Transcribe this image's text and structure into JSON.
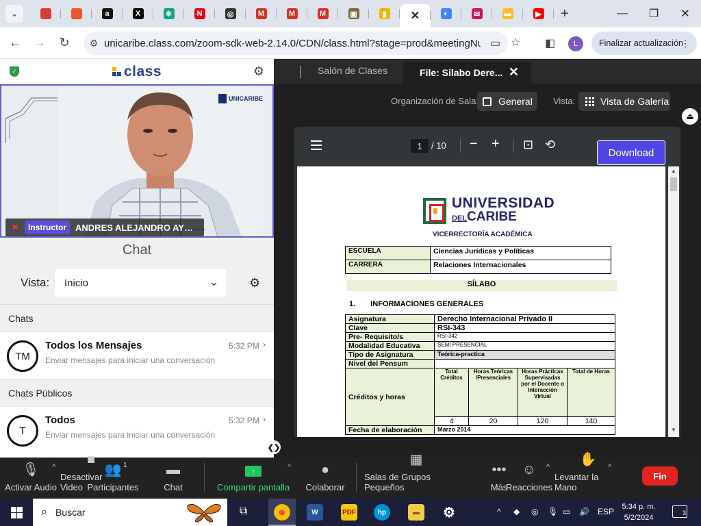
{
  "browser": {
    "tabs": [
      {
        "icon": "tab-dropdown-icon"
      },
      {
        "icon": "partner-logo-icon",
        "color": "#d43f3a"
      },
      {
        "icon": "arch-logo-icon",
        "color": "#e8582a"
      },
      {
        "icon": "amazon-icon",
        "glyph": "a",
        "color": "#111111"
      },
      {
        "icon": "x-twitter-icon",
        "glyph": "X",
        "color": "#000000"
      },
      {
        "icon": "chatgpt-icon",
        "glyph": "⎈",
        "color": "#10a37f"
      },
      {
        "icon": "netflix-icon",
        "glyph": "N",
        "color": "#e50914"
      },
      {
        "icon": "circle-logo-icon",
        "glyph": "◎",
        "color": "#333333"
      },
      {
        "icon": "gmail-icon",
        "glyph": "M",
        "color": "#d93025"
      },
      {
        "icon": "gmail-icon",
        "glyph": "M",
        "color": "#d93025"
      },
      {
        "icon": "gmail-icon",
        "glyph": "M",
        "color": "#d93025"
      },
      {
        "icon": "timer-icon",
        "glyph": "▣",
        "color": "#7a6a3b"
      },
      {
        "icon": "chart-bars-icon",
        "glyph": "▮",
        "color": "#f4b400"
      },
      {
        "icon": "close-icon",
        "glyph": "✕",
        "active": true
      },
      {
        "icon": "chrome-icon",
        "glyph": "◐",
        "color": "#4285f4"
      },
      {
        "icon": "mail-icon",
        "glyph": "✉",
        "color": "#c2185b"
      },
      {
        "icon": "note-icon",
        "glyph": "▬",
        "color": "#f6c026"
      },
      {
        "icon": "youtube-icon",
        "glyph": "▶",
        "color": "#ff0000"
      }
    ],
    "new_tab": "+",
    "url": "unicaribe.class.com/zoom-sdk-web-2.14.0/CDN/class.html?stage=prod&meetingNumb...",
    "profile_initial": "L",
    "update_button": "Finalizar actualización"
  },
  "class_app": {
    "logo": "class",
    "video": {
      "school_logo": "UNICARIBE",
      "role_badge": "Instructor",
      "name": "ANDRES ALEJANDRO AYBA..."
    },
    "chat": {
      "title": "Chat",
      "vista_label": "Vista:",
      "vista_value": "Inicio",
      "sections": [
        {
          "title": "Chats",
          "items": [
            {
              "avatar": "TM",
              "name": "Todos los Mensajes",
              "time": "5:32 PM",
              "preview": "Enviar mensajes para iniciar una conversación"
            }
          ]
        },
        {
          "title": "Chats Públicos",
          "items": [
            {
              "avatar": "T",
              "name": "Todos",
              "time": "5:32 PM",
              "preview": "Enviar mensajes para iniciar una conversación"
            }
          ]
        }
      ]
    },
    "share_tabs": {
      "inactive": "Salón de Clases",
      "active": "File: Silabo Dere..."
    },
    "organizacion_label": "Organización de Sala:",
    "organizacion_value": "General",
    "vista_label": "Vista:",
    "vista_value": "Vista de Galería"
  },
  "pdf": {
    "page_current": "1",
    "page_total": "/ 10",
    "download": "Download",
    "doc": {
      "univ_line1": "UNIVERSIDAD",
      "univ_line2_a": "DEL",
      "univ_line2_b": "CARIBE",
      "vicerrectoria": "VICERRECTORÍA ACADÉMICA",
      "escuela_k": "ESCUELA",
      "escuela_v": "Ciencias Jurídicas y Políticas",
      "carrera_k": "CARRERA",
      "carrera_v": "Relaciones Internacionales",
      "silabo": "SÍLABO",
      "sec_num": "1.",
      "sec_title": "INFORMACIONES GENERALES",
      "asignatura_k": "Asignatura",
      "asignatura_v": "Derecho Internacional Privado II",
      "clave_k": "Clave",
      "clave_v": "RSI-343",
      "prereq_k": "Pre- Requisito/s",
      "prereq_v": "RSI-342",
      "modalidad_k": "Modalidad Educativa",
      "modalidad_v": "SEMI PRESENCIAL",
      "tipo_k": "Tipo de Asignatura",
      "tipo_v": "Teórica-practica",
      "nivel_k": "Nivel del Pensum",
      "creditos_k": "Créditos y horas",
      "col1": "Total Créditos",
      "col2": "Horas Teóricas /Presenciales",
      "col3": "Horas Prácticas Supervisadas por el Docente o Interacción Virtual",
      "col4": "Total de Horas",
      "v1": "4",
      "v2": "20",
      "v3": "120",
      "v4": "140",
      "fecha_k": "Fecha de elaboración",
      "fecha_v": "Marzo 2014"
    }
  },
  "zoom_bar": {
    "audio": "Activar Audio",
    "video": "Desactivar Video",
    "participants": "Participantes",
    "participants_count": "1",
    "chat": "Chat",
    "share": "Compartir pantalla",
    "collaborate": "Colaborar",
    "breakout": "Salas de Grupos Pequeños",
    "more": "Más",
    "reactions": "Reacciones",
    "raise_hand": "Levantar la Mano",
    "end": "Fin"
  },
  "taskbar": {
    "search": "Buscar",
    "lang": "ESP",
    "time": "5:34 p. m.",
    "date": "5/2/2024",
    "notifications": "3"
  }
}
